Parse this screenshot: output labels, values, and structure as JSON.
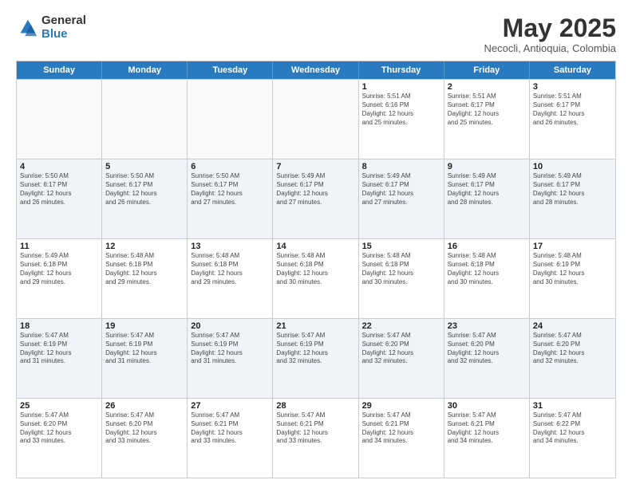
{
  "logo": {
    "general": "General",
    "blue": "Blue"
  },
  "title": "May 2025",
  "subtitle": "Necocli, Antioquia, Colombia",
  "headers": [
    "Sunday",
    "Monday",
    "Tuesday",
    "Wednesday",
    "Thursday",
    "Friday",
    "Saturday"
  ],
  "weeks": [
    [
      {
        "day": "",
        "info": "",
        "empty": true
      },
      {
        "day": "",
        "info": "",
        "empty": true
      },
      {
        "day": "",
        "info": "",
        "empty": true
      },
      {
        "day": "",
        "info": "",
        "empty": true
      },
      {
        "day": "1",
        "info": "Sunrise: 5:51 AM\nSunset: 6:16 PM\nDaylight: 12 hours\nand 25 minutes."
      },
      {
        "day": "2",
        "info": "Sunrise: 5:51 AM\nSunset: 6:17 PM\nDaylight: 12 hours\nand 25 minutes."
      },
      {
        "day": "3",
        "info": "Sunrise: 5:51 AM\nSunset: 6:17 PM\nDaylight: 12 hours\nand 26 minutes."
      }
    ],
    [
      {
        "day": "4",
        "info": "Sunrise: 5:50 AM\nSunset: 6:17 PM\nDaylight: 12 hours\nand 26 minutes."
      },
      {
        "day": "5",
        "info": "Sunrise: 5:50 AM\nSunset: 6:17 PM\nDaylight: 12 hours\nand 26 minutes."
      },
      {
        "day": "6",
        "info": "Sunrise: 5:50 AM\nSunset: 6:17 PM\nDaylight: 12 hours\nand 27 minutes."
      },
      {
        "day": "7",
        "info": "Sunrise: 5:49 AM\nSunset: 6:17 PM\nDaylight: 12 hours\nand 27 minutes."
      },
      {
        "day": "8",
        "info": "Sunrise: 5:49 AM\nSunset: 6:17 PM\nDaylight: 12 hours\nand 27 minutes."
      },
      {
        "day": "9",
        "info": "Sunrise: 5:49 AM\nSunset: 6:17 PM\nDaylight: 12 hours\nand 28 minutes."
      },
      {
        "day": "10",
        "info": "Sunrise: 5:49 AM\nSunset: 6:17 PM\nDaylight: 12 hours\nand 28 minutes."
      }
    ],
    [
      {
        "day": "11",
        "info": "Sunrise: 5:49 AM\nSunset: 6:18 PM\nDaylight: 12 hours\nand 29 minutes."
      },
      {
        "day": "12",
        "info": "Sunrise: 5:48 AM\nSunset: 6:18 PM\nDaylight: 12 hours\nand 29 minutes."
      },
      {
        "day": "13",
        "info": "Sunrise: 5:48 AM\nSunset: 6:18 PM\nDaylight: 12 hours\nand 29 minutes."
      },
      {
        "day": "14",
        "info": "Sunrise: 5:48 AM\nSunset: 6:18 PM\nDaylight: 12 hours\nand 30 minutes."
      },
      {
        "day": "15",
        "info": "Sunrise: 5:48 AM\nSunset: 6:18 PM\nDaylight: 12 hours\nand 30 minutes."
      },
      {
        "day": "16",
        "info": "Sunrise: 5:48 AM\nSunset: 6:18 PM\nDaylight: 12 hours\nand 30 minutes."
      },
      {
        "day": "17",
        "info": "Sunrise: 5:48 AM\nSunset: 6:19 PM\nDaylight: 12 hours\nand 30 minutes."
      }
    ],
    [
      {
        "day": "18",
        "info": "Sunrise: 5:47 AM\nSunset: 6:19 PM\nDaylight: 12 hours\nand 31 minutes."
      },
      {
        "day": "19",
        "info": "Sunrise: 5:47 AM\nSunset: 6:19 PM\nDaylight: 12 hours\nand 31 minutes."
      },
      {
        "day": "20",
        "info": "Sunrise: 5:47 AM\nSunset: 6:19 PM\nDaylight: 12 hours\nand 31 minutes."
      },
      {
        "day": "21",
        "info": "Sunrise: 5:47 AM\nSunset: 6:19 PM\nDaylight: 12 hours\nand 32 minutes."
      },
      {
        "day": "22",
        "info": "Sunrise: 5:47 AM\nSunset: 6:20 PM\nDaylight: 12 hours\nand 32 minutes."
      },
      {
        "day": "23",
        "info": "Sunrise: 5:47 AM\nSunset: 6:20 PM\nDaylight: 12 hours\nand 32 minutes."
      },
      {
        "day": "24",
        "info": "Sunrise: 5:47 AM\nSunset: 6:20 PM\nDaylight: 12 hours\nand 32 minutes."
      }
    ],
    [
      {
        "day": "25",
        "info": "Sunrise: 5:47 AM\nSunset: 6:20 PM\nDaylight: 12 hours\nand 33 minutes."
      },
      {
        "day": "26",
        "info": "Sunrise: 5:47 AM\nSunset: 6:20 PM\nDaylight: 12 hours\nand 33 minutes."
      },
      {
        "day": "27",
        "info": "Sunrise: 5:47 AM\nSunset: 6:21 PM\nDaylight: 12 hours\nand 33 minutes."
      },
      {
        "day": "28",
        "info": "Sunrise: 5:47 AM\nSunset: 6:21 PM\nDaylight: 12 hours\nand 33 minutes."
      },
      {
        "day": "29",
        "info": "Sunrise: 5:47 AM\nSunset: 6:21 PM\nDaylight: 12 hours\nand 34 minutes."
      },
      {
        "day": "30",
        "info": "Sunrise: 5:47 AM\nSunset: 6:21 PM\nDaylight: 12 hours\nand 34 minutes."
      },
      {
        "day": "31",
        "info": "Sunrise: 5:47 AM\nSunset: 6:22 PM\nDaylight: 12 hours\nand 34 minutes."
      }
    ]
  ]
}
